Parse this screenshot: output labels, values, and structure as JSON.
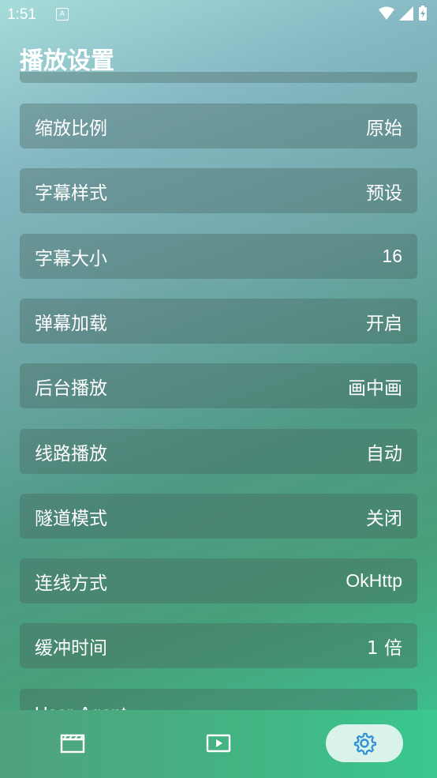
{
  "status_bar": {
    "time": "1:51"
  },
  "page": {
    "title": "播放设置"
  },
  "settings": [
    {
      "label": "缩放比例",
      "value": "原始"
    },
    {
      "label": "字幕样式",
      "value": "预设"
    },
    {
      "label": "字幕大小",
      "value": "16"
    },
    {
      "label": "弹幕加载",
      "value": "开启"
    },
    {
      "label": "后台播放",
      "value": "画中画"
    },
    {
      "label": "线路播放",
      "value": "自动"
    },
    {
      "label": "隧道模式",
      "value": "关闭"
    },
    {
      "label": "连线方式",
      "value": "OkHttp"
    },
    {
      "label": "缓冲时间",
      "value": "1 倍"
    },
    {
      "label": "User-Agent",
      "value": ""
    }
  ],
  "bottom_nav": {
    "items": [
      {
        "icon": "clapperboard-icon"
      },
      {
        "icon": "play-icon"
      },
      {
        "icon": "gear-icon",
        "active": true
      }
    ],
    "active_color": "#2f8fd8"
  }
}
